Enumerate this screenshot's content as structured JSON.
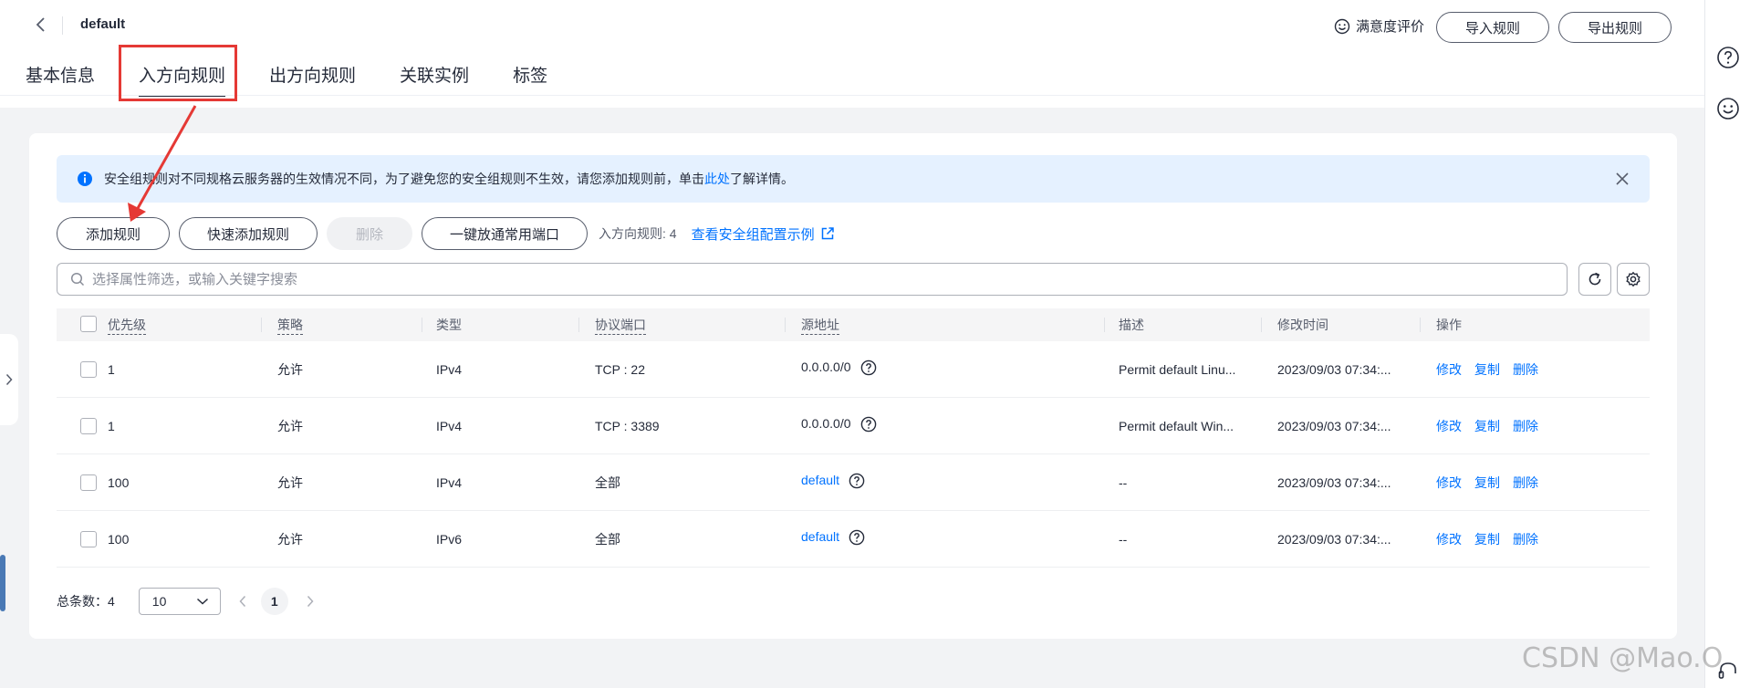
{
  "header": {
    "title": "default",
    "satisfaction_label": "满意度评价",
    "import_label": "导入规则",
    "export_label": "导出规则"
  },
  "tabs": [
    {
      "label": "基本信息"
    },
    {
      "label": "入方向规则"
    },
    {
      "label": "出方向规则"
    },
    {
      "label": "关联实例"
    },
    {
      "label": "标签"
    }
  ],
  "alert": {
    "text_before": "安全组规则对不同规格云服务器的生效情况不同，为了避免您的安全组规则不生效，请您添加规则前，单击",
    "link": "此处",
    "text_after": "了解详情。"
  },
  "toolbar": {
    "add_rule": "添加规则",
    "quick_add": "快速添加规则",
    "delete": "删除",
    "open_ports": "一键放通常用端口",
    "count_text": "入方向规则: 4",
    "example_link": "查看安全组配置示例"
  },
  "search": {
    "placeholder": "选择属性筛选，或输入关键字搜索"
  },
  "table": {
    "headers": {
      "priority": "优先级",
      "policy": "策略",
      "type": "类型",
      "port": "协议端口",
      "source": "源地址",
      "desc": "描述",
      "modified": "修改时间",
      "ops": "操作"
    },
    "rows": [
      {
        "priority": "1",
        "policy": "允许",
        "type": "IPv4",
        "port": "TCP : 22",
        "source": "0.0.0.0/0",
        "desc": "Permit default Linu...",
        "modified": "2023/09/03 07:34:...",
        "edit": "修改",
        "copy": "复制",
        "del": "删除"
      },
      {
        "priority": "1",
        "policy": "允许",
        "type": "IPv4",
        "port": "TCP : 3389",
        "source": "0.0.0.0/0",
        "desc": "Permit default Win...",
        "modified": "2023/09/03 07:34:...",
        "edit": "修改",
        "copy": "复制",
        "del": "删除"
      },
      {
        "priority": "100",
        "policy": "允许",
        "type": "IPv4",
        "port": "全部",
        "source": "default",
        "desc": "--",
        "modified": "2023/09/03 07:34:...",
        "edit": "修改",
        "copy": "复制",
        "del": "删除"
      },
      {
        "priority": "100",
        "policy": "允许",
        "type": "IPv6",
        "port": "全部",
        "source": "default",
        "desc": "--",
        "modified": "2023/09/03 07:34:...",
        "edit": "修改",
        "copy": "复制",
        "del": "删除"
      }
    ]
  },
  "pagination": {
    "total_label": "总条数：4",
    "page_size": "10",
    "current_page": "1"
  },
  "watermark": "CSDN @Mao.O",
  "colors": {
    "accent": "#0072ff",
    "annotation": "#e53935"
  }
}
